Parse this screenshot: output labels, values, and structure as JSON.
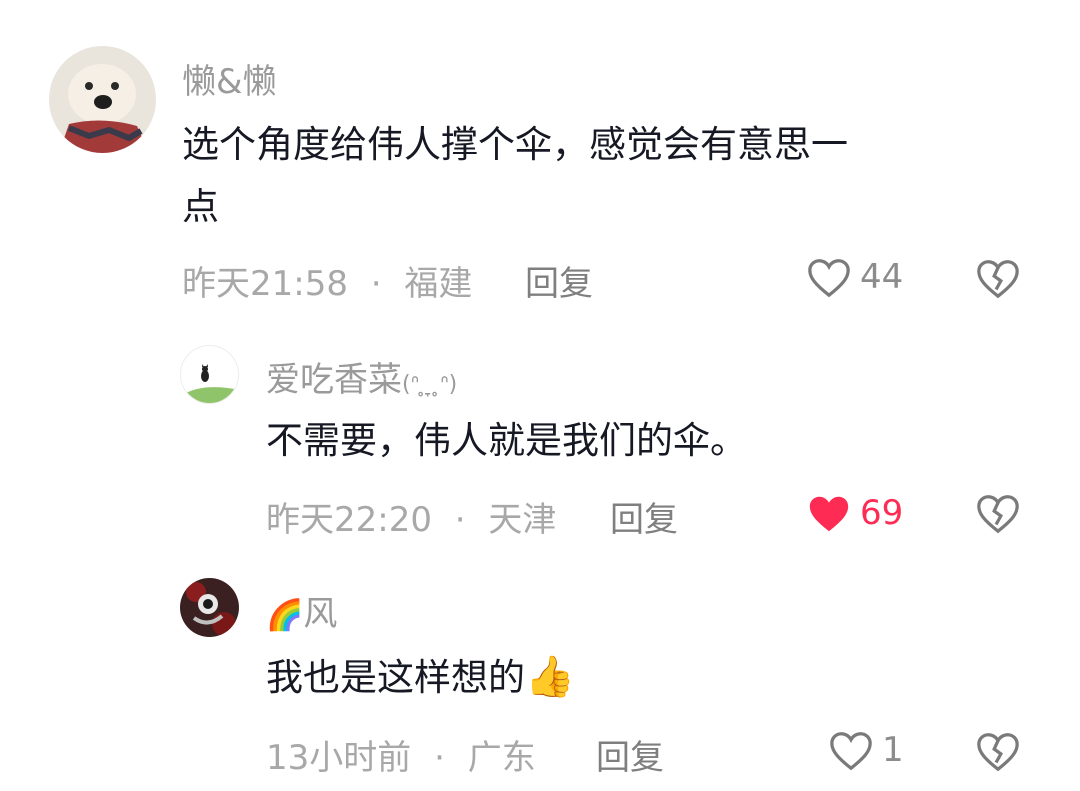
{
  "colors": {
    "username": "#9a9a9a",
    "text": "#161823",
    "meta": "#a8a8a8",
    "liked": "#fe2c55",
    "icon": "#7a7a7a"
  },
  "comments": [
    {
      "username": "懒&懒",
      "text_line1": "选个角度给伟人撑个伞，感觉会有意思一",
      "text_line2": "点",
      "time": "昨天21:58",
      "location": "福建",
      "reply_label": "回复",
      "likes": "44",
      "liked": false
    },
    {
      "username": "爱吃香菜",
      "username_kaomoji": "(ᐢ ̥ ̞ ̥ᐢ)",
      "text": "不需要，伟人就是我们的伞。",
      "time": "昨天22:20",
      "location": "天津",
      "reply_label": "回复",
      "likes": "69",
      "liked": true
    },
    {
      "username_emoji": "🌈",
      "username": "风",
      "text": "我也是这样想的",
      "text_emoji": "👍",
      "time": "13小时前",
      "location": "广东",
      "reply_label": "回复",
      "likes": "1",
      "liked": false
    }
  ],
  "separator": "·",
  "icons": {
    "like": "heart-outline-icon",
    "liked": "heart-filled-icon",
    "dislike": "broken-heart-icon"
  }
}
